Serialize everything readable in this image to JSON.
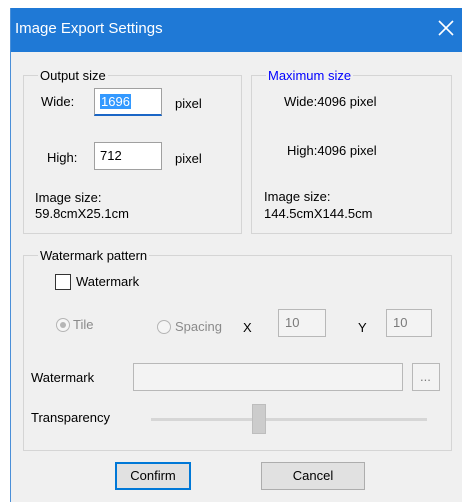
{
  "dialog": {
    "title": "Image Export Settings",
    "close_icon": "close-icon",
    "accent_color": "#1f79d6"
  },
  "output_size": {
    "legend": "Output size",
    "wide_label": "Wide:",
    "wide_value": "1696",
    "wide_unit": "pixel",
    "high_label": "High:",
    "high_value": "712",
    "high_unit": "pixel",
    "image_size_label": "Image size:",
    "image_size_value": "59.8cmX25.1cm"
  },
  "maximum_size": {
    "legend": "Maximum size",
    "legend_color": "#0000ff",
    "wide_text": "Wide:4096 pixel",
    "high_text": "High:4096 pixel",
    "image_size_label": "Image size:",
    "image_size_value": "144.5cmX144.5cm"
  },
  "watermark": {
    "legend": "Watermark pattern",
    "checkbox_label": "Watermark",
    "checked": false,
    "tile_label": "Tile",
    "tile_selected": true,
    "spacing_label": "Spacing",
    "spacing_selected": false,
    "x_label": "X",
    "x_value": "10",
    "y_label": "Y",
    "y_value": "10",
    "file_label": "Watermark",
    "file_value": "",
    "browse_label": "...",
    "transparency_label": "Transparency",
    "transparency_level": 0.5
  },
  "buttons": {
    "confirm": "Confirm",
    "cancel": "Cancel"
  }
}
